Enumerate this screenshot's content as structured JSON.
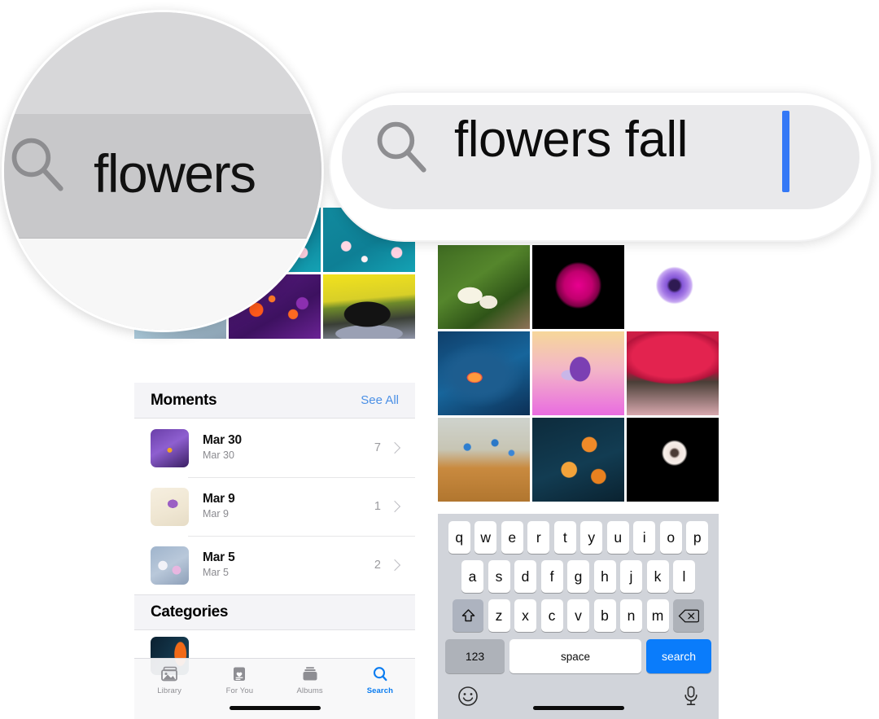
{
  "app": {
    "name": "Photos",
    "platform": "iOS"
  },
  "callout_left": {
    "name": "magnified-search-term",
    "search_text": "flowers",
    "icon": "search-icon"
  },
  "callout_right": {
    "name": "magnified-search-field",
    "search_text": "flowers fall",
    "icon": "search-icon",
    "caret_color": "#3478f6",
    "field_bg": "#e9e9eb"
  },
  "phone_left": {
    "photo_grid": {
      "name": "photo-results-grid",
      "cells": [
        {
          "id": "cell-1",
          "desc": "blossom-blue"
        },
        {
          "id": "cell-2",
          "desc": "blossom-teal"
        },
        {
          "id": "cell-3",
          "desc": "blossom-teal"
        },
        {
          "id": "cell-4",
          "desc": "blossom-blue"
        },
        {
          "id": "cell-5",
          "desc": "purple-orange"
        },
        {
          "id": "cell-6",
          "desc": "dog-yellow"
        }
      ]
    },
    "moments": {
      "title": "Moments",
      "see_all": "See All",
      "rows": [
        {
          "title": "Mar 30",
          "subtitle": "Mar 30",
          "count": "7",
          "thumb": "purple-crocus"
        },
        {
          "title": "Mar 9",
          "subtitle": "Mar 9",
          "count": "1",
          "thumb": "cream-flower"
        },
        {
          "title": "Mar 5",
          "subtitle": "Mar 5",
          "count": "2",
          "thumb": "lavender-bokeh"
        }
      ]
    },
    "categories": {
      "title": "Categories"
    },
    "tabbar": {
      "items": [
        {
          "label": "Library",
          "icon": "photos-library-icon",
          "active": false
        },
        {
          "label": "For You",
          "icon": "for-you-heart-card-icon",
          "active": false
        },
        {
          "label": "Albums",
          "icon": "albums-stack-icon",
          "active": false
        },
        {
          "label": "Search",
          "icon": "search-magnifier-icon",
          "active": true
        }
      ],
      "active_color": "#0a7cf0",
      "inactive_color": "#8e8e93"
    }
  },
  "phone_right": {
    "photo_grid": {
      "name": "photo-results-grid",
      "cells": [
        {
          "id": "cell-1",
          "desc": "hosta-white-flowers"
        },
        {
          "id": "cell-2",
          "desc": "magenta-dahlia-black"
        },
        {
          "id": "cell-3",
          "desc": "purple-anemone-white"
        },
        {
          "id": "cell-4",
          "desc": "leaf-on-blue-water"
        },
        {
          "id": "cell-5",
          "desc": "purple-iris-pink-gradient"
        },
        {
          "id": "cell-6",
          "desc": "red-autumn-tree"
        },
        {
          "id": "cell-7",
          "desc": "blue-cornflowers-field"
        },
        {
          "id": "cell-8",
          "desc": "orange-tulips-dark"
        },
        {
          "id": "cell-9",
          "desc": "white-daisy-black"
        }
      ]
    },
    "keyboard": {
      "row1": [
        "q",
        "w",
        "e",
        "r",
        "t",
        "y",
        "u",
        "i",
        "o",
        "p"
      ],
      "row2": [
        "a",
        "s",
        "d",
        "f",
        "g",
        "h",
        "j",
        "k",
        "l"
      ],
      "row3": [
        "z",
        "x",
        "c",
        "v",
        "b",
        "n",
        "m"
      ],
      "shift_icon": "shift-arrow-icon",
      "delete_icon": "delete-backspace-icon",
      "numbers_label": "123",
      "space_label": "space",
      "return_label": "search",
      "emoji_icon": "emoji-smiley-icon",
      "dictation_icon": "microphone-icon",
      "return_color": "#0a7cfb",
      "background": "#d1d4da"
    }
  }
}
